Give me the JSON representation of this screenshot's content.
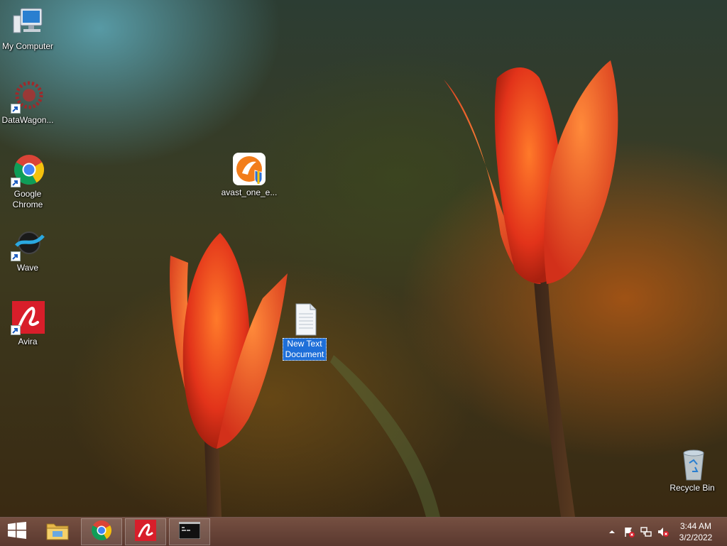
{
  "desktop": {
    "icons": [
      {
        "label": "My Computer",
        "icon": "computer-icon"
      },
      {
        "label": "DataWagon...",
        "icon": "datawagon-icon"
      },
      {
        "label": "Google\nChrome",
        "icon": "chrome-icon"
      },
      {
        "label": "Wave",
        "icon": "wave-icon"
      },
      {
        "label": "Avira",
        "icon": "avira-icon"
      },
      {
        "label": "avast_one_e...",
        "icon": "avast-installer-icon"
      },
      {
        "label": "New Text\nDocument",
        "icon": "text-document-icon",
        "selected": true
      },
      {
        "label": "Recycle Bin",
        "icon": "recycle-bin-icon"
      }
    ]
  },
  "taskbar": {
    "start": {
      "icon": "windows-logo-icon"
    },
    "buttons": [
      {
        "name": "file-explorer",
        "icon": "folder-icon"
      },
      {
        "name": "google-chrome",
        "icon": "chrome-icon",
        "active": true
      },
      {
        "name": "avira",
        "icon": "avira-icon",
        "active": true
      },
      {
        "name": "command-prompt",
        "icon": "cmd-icon",
        "active": true
      }
    ],
    "tray": {
      "icons": [
        "show-hidden-icons-chevron",
        "action-center-flag-icon",
        "network-icon",
        "volume-muted-icon"
      ],
      "time": "3:44 AM",
      "date": "3/2/2022"
    }
  },
  "colors": {
    "selection": "#1e6fd9",
    "avira_red": "#d81e2a",
    "avast_orange": "#f27d1b",
    "taskbar": "#5a3628"
  }
}
